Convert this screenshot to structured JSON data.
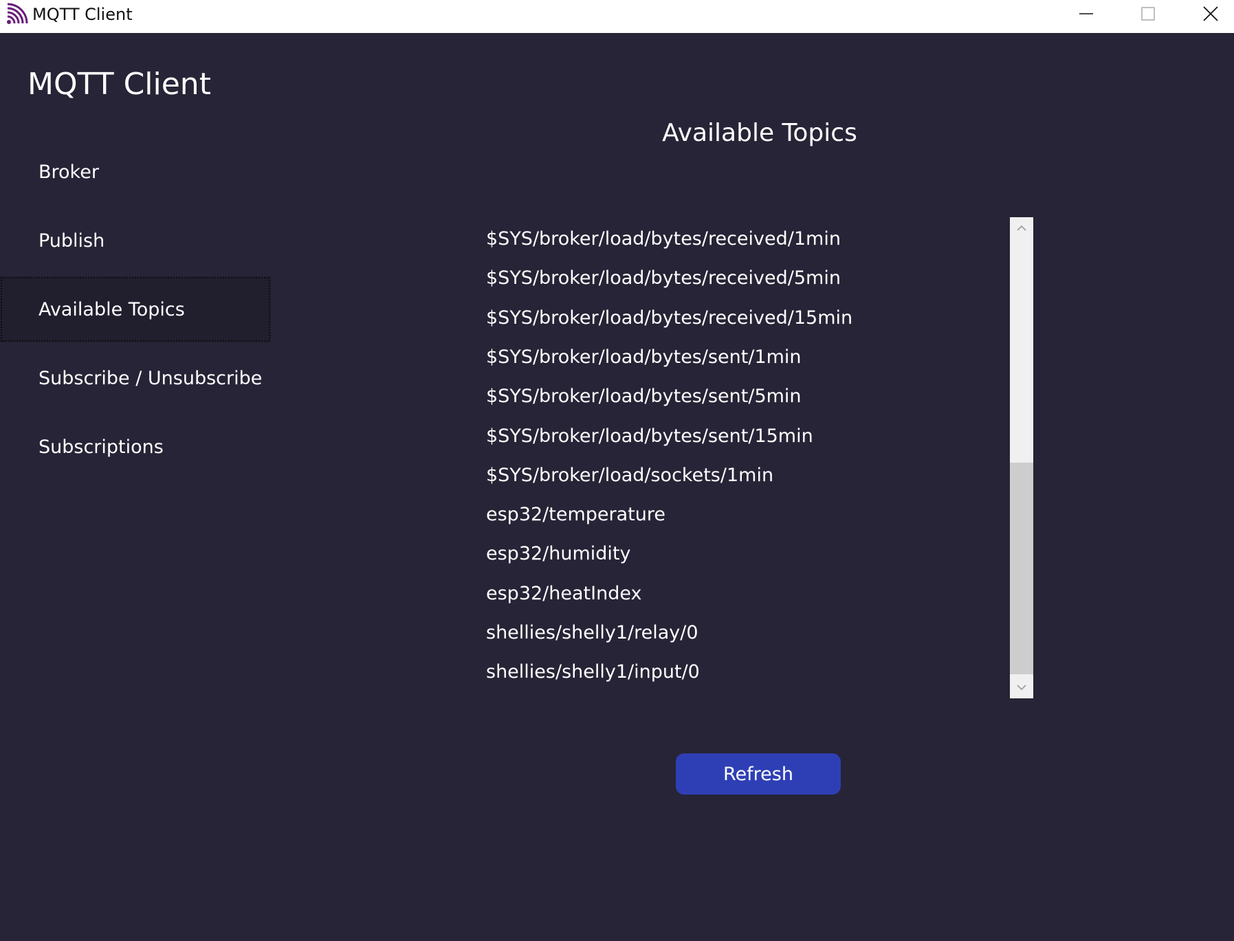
{
  "window": {
    "title": "MQTT Client",
    "minimize_icon": "minimize-icon",
    "maximize_icon": "maximize-icon",
    "close_icon": "close-icon"
  },
  "app": {
    "title": "MQTT Client",
    "icon": "rss-feed-icon"
  },
  "nav": {
    "items": [
      {
        "label": "Broker",
        "selected": false
      },
      {
        "label": "Publish",
        "selected": false
      },
      {
        "label": "Available Topics",
        "selected": true
      },
      {
        "label": "Subscribe / Unsubscribe",
        "selected": false
      },
      {
        "label": "Subscriptions",
        "selected": false
      }
    ]
  },
  "main": {
    "title": "Available Topics",
    "topics": [
      "$SYS/broker/load/bytes/received/1min",
      "$SYS/broker/load/bytes/received/5min",
      "$SYS/broker/load/bytes/received/15min",
      "$SYS/broker/load/bytes/sent/1min",
      "$SYS/broker/load/bytes/sent/5min",
      "$SYS/broker/load/bytes/sent/15min",
      "$SYS/broker/load/sockets/1min",
      "esp32/temperature",
      "esp32/humidity",
      "esp32/heatIndex",
      "shellies/shelly1/relay/0",
      "shellies/shelly1/input/0"
    ],
    "refresh_label": "Refresh"
  },
  "colors": {
    "background": "#262436",
    "accent": "#2e3fb5",
    "selected_nav": "#211f2e"
  }
}
